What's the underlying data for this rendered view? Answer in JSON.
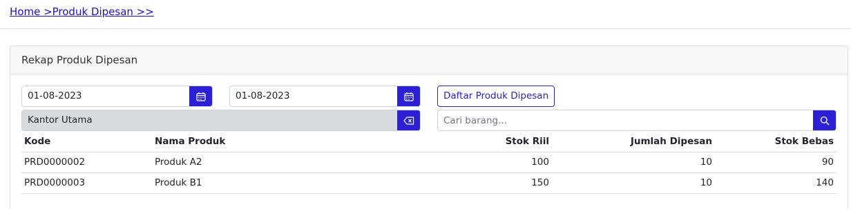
{
  "breadcrumb": {
    "home": "Home >",
    "current": "Produk Dipesan >>"
  },
  "card": {
    "title": "Rekap Produk Dipesan"
  },
  "filters": {
    "date_start": "01-08-2023",
    "date_end": "01-08-2023",
    "branch": "Kantor Utama",
    "list_button": "Daftar Produk Dipesan",
    "search_placeholder": "Cari barang..."
  },
  "table": {
    "headers": [
      "Kode",
      "Nama Produk",
      "Stok Riil",
      "Jumlah Dipesan",
      "Stok Bebas"
    ],
    "rows": [
      [
        "PRD0000002",
        "Produk A2",
        "100",
        "10",
        "90"
      ],
      [
        "PRD0000003",
        "Produk B1",
        "150",
        "10",
        "140"
      ]
    ]
  },
  "colors": {
    "accent": "#2b20d4",
    "link": "#1a10c8",
    "disabled_bg": "#d7dbdf"
  }
}
